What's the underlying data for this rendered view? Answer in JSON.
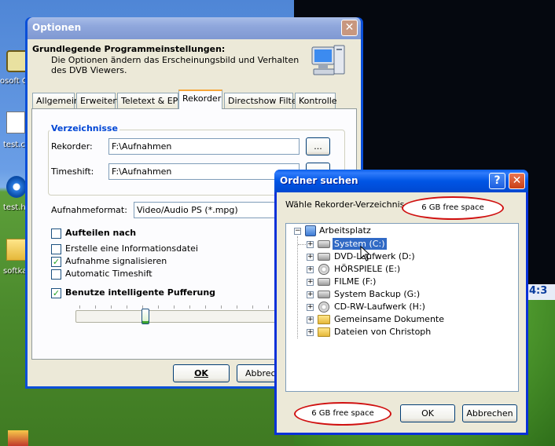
{
  "desktop": {
    "icons": [
      {
        "name": "microsoft-icon",
        "label": "osoft C"
      },
      {
        "name": "test-document-icon",
        "label": "test.c"
      },
      {
        "name": "internet-explorer-icon",
        "label": "test.h"
      },
      {
        "name": "folder-icon",
        "label": "softka"
      }
    ],
    "right_edge_fragment": "4:3"
  },
  "options_window": {
    "title": "Optionen",
    "close": "✕",
    "header_title": "Grundlegende Programmeinstellungen:",
    "header_desc": "Die Optionen ändern das Erscheinungsbild und Verhalten des DVB Viewers.",
    "tabs": [
      "Allgemein",
      "Erweitert",
      "Teletext & EPG",
      "Rekorder",
      "Directshow Filter",
      "Kontrolle"
    ],
    "active_tab": "Rekorder",
    "group_title": "Verzeichnisse",
    "recorder_label": "Rekorder:",
    "recorder_value": "F:\\Aufnahmen",
    "timeshift_label": "Timeshift:",
    "timeshift_value": "F:\\Aufnahmen",
    "browse_label": "...",
    "format_label": "Aufnahmeformat:",
    "format_value": "Video/Audio PS  (*.mpg)",
    "checkboxes": [
      {
        "label": "Aufteilen nach",
        "checked": false
      },
      {
        "label": "Erstelle eine Informationsdatei",
        "checked": false
      },
      {
        "label": "Aufnahme signalisieren",
        "checked": true
      },
      {
        "label": "Automatic Timeshift",
        "checked": false
      },
      {
        "label": "Benutze intelligente Pufferung",
        "checked": true
      }
    ],
    "ok": "OK",
    "cancel": "Abbrech"
  },
  "folder_dialog": {
    "title": "Ordner suchen",
    "help": "?",
    "close": "✕",
    "prompt": "Wähle Rekorder-Verzeichnis",
    "annotation_top": "6 GB free space",
    "annotation_bottom": "6 GB free space",
    "tree_root": "Arbeitsplatz",
    "tree_items": [
      {
        "label": "System (C:)",
        "icon": "hard-drive-icon",
        "selected": true
      },
      {
        "label": "DVD-Laufwerk (D:)",
        "icon": "hard-drive-icon",
        "selected": false
      },
      {
        "label": "HÖRSPIELE (E:)",
        "icon": "cd-drive-icon",
        "selected": false
      },
      {
        "label": "FILME (F:)",
        "icon": "hard-drive-icon",
        "selected": false
      },
      {
        "label": "System Backup (G:)",
        "icon": "hard-drive-icon",
        "selected": false
      },
      {
        "label": "CD-RW-Laufwerk (H:)",
        "icon": "cd-drive-icon",
        "selected": false
      },
      {
        "label": "Gemeinsame Dokumente",
        "icon": "folder-icon",
        "selected": false
      },
      {
        "label": "Dateien von Christoph",
        "icon": "folder-icon",
        "selected": false
      }
    ],
    "ok": "OK",
    "cancel": "Abbrechen"
  },
  "colors": {
    "accent_blue": "#0055e5",
    "selection": "#316ac5",
    "annotation_red": "#d01010"
  }
}
